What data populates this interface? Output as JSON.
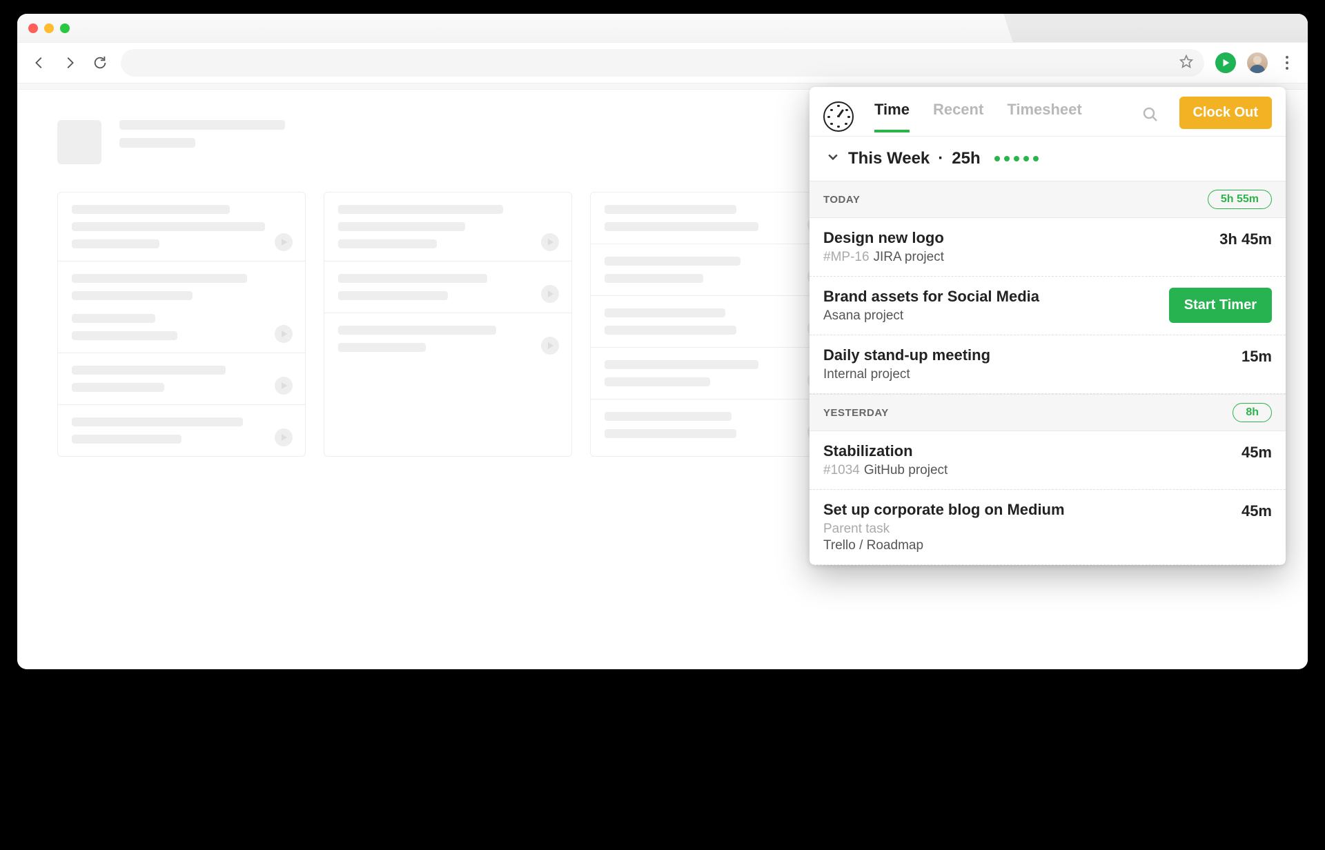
{
  "popup": {
    "tabs": {
      "time": "Time",
      "recent": "Recent",
      "timesheet": "Timesheet"
    },
    "clock_out": "Clock Out",
    "week": {
      "label": "This Week",
      "sep": "·",
      "total": "25h"
    },
    "sections": [
      {
        "label": "TODAY",
        "pill": "5h 55m",
        "entries": [
          {
            "title": "Design new logo",
            "tag": "#MP-16",
            "project": "JIRA project",
            "duration": "3h 45m"
          },
          {
            "title": "Brand assets for Social Media",
            "project": "Asana project",
            "action": "Start Timer"
          },
          {
            "title": "Daily stand-up meeting",
            "project": "Internal project",
            "duration": "15m"
          }
        ]
      },
      {
        "label": "YESTERDAY",
        "pill": "8h",
        "entries": [
          {
            "title": "Stabilization",
            "tag": "#1034",
            "project": "GitHub project",
            "duration": "45m"
          },
          {
            "title": "Set up corporate blog on Medium",
            "parent": "Parent task",
            "project": "Trello / Roadmap",
            "duration": "45m"
          }
        ]
      }
    ]
  }
}
